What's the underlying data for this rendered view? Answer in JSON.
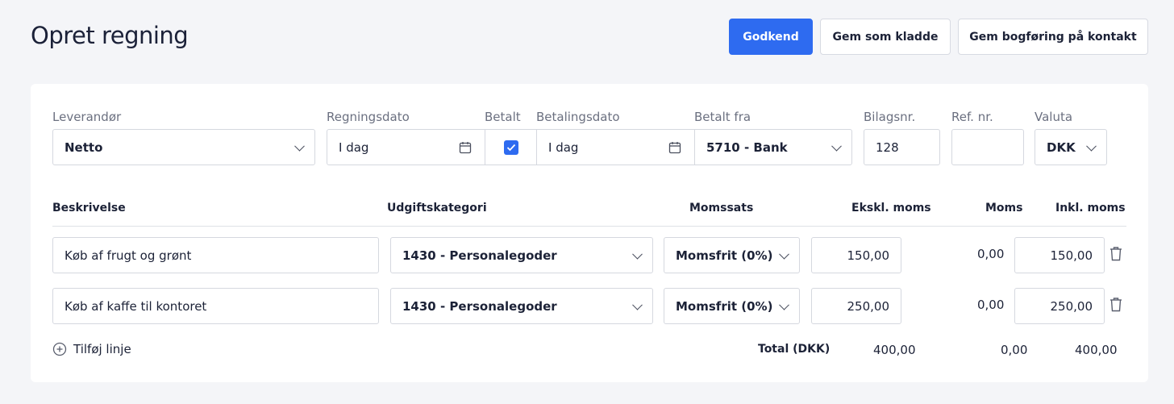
{
  "header": {
    "title": "Opret regning",
    "approve_label": "Godkend",
    "draft_label": "Gem som kladde",
    "save_contact_label": "Gem bogføring på kontakt"
  },
  "form": {
    "supplier_label": "Leverandør",
    "supplier_value": "Netto",
    "invoice_date_label": "Regningsdato",
    "invoice_date_value": "I dag",
    "paid_label": "Betalt",
    "paid_checked": true,
    "payment_date_label": "Betalingsdato",
    "payment_date_value": "I dag",
    "paid_from_label": "Betalt fra",
    "paid_from_value": "5710 - Bank",
    "voucher_label": "Bilagsnr.",
    "voucher_value": "128",
    "ref_label": "Ref. nr.",
    "ref_value": "",
    "currency_label": "Valuta",
    "currency_value": "DKK"
  },
  "lines": {
    "headers": {
      "description": "Beskrivelse",
      "category": "Udgiftskategori",
      "vat_rate": "Momssats",
      "excl": "Ekskl. moms",
      "vat": "Moms",
      "incl": "Inkl. moms"
    },
    "rows": [
      {
        "description": "Køb af frugt og grønt",
        "category": "1430 - Personalegoder",
        "vat_rate": "Momsfrit (0%)",
        "excl": "150,00",
        "vat": "0,00",
        "incl": "150,00"
      },
      {
        "description": "Køb af kaffe til kontoret",
        "category": "1430 - Personalegoder",
        "vat_rate": "Momsfrit (0%)",
        "excl": "250,00",
        "vat": "0,00",
        "incl": "250,00"
      }
    ],
    "add_line_label": "Tilføj linje"
  },
  "totals": {
    "label": "Total (DKK)",
    "excl": "400,00",
    "vat": "0,00",
    "incl": "400,00"
  },
  "colors": {
    "accent": "#2e6bf0",
    "background": "#f4f5f8",
    "border": "#d5d8df"
  },
  "icons": [
    "calendar-icon",
    "chevron-down-icon",
    "check-icon",
    "trash-icon",
    "plus-circle-icon"
  ]
}
